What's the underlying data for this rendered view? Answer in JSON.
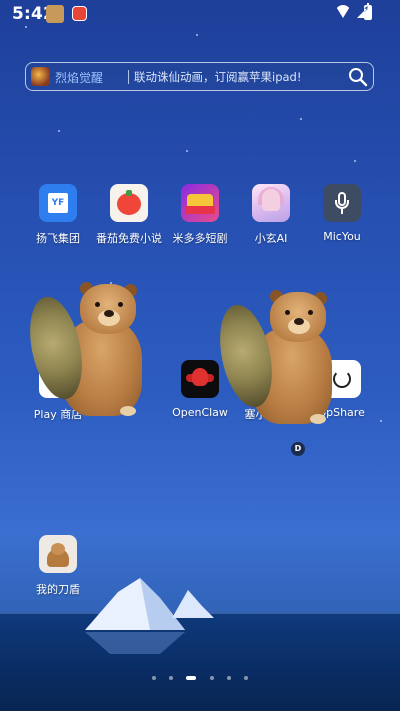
{
  "status_bar": {
    "time": "5:42",
    "icons": [
      "notification-avatar-icon",
      "notification-app-icon",
      "wifi-icon",
      "signal-icon",
      "battery-charging-icon"
    ]
  },
  "search_widget": {
    "app_name": "烈焰觉醒",
    "hint": "联动诛仙动画，订阅赢苹果ipad!",
    "icon": "search-icon"
  },
  "apps_row1": [
    {
      "label": "扬飞集团",
      "icon": "yangfei-icon",
      "logo_text": "YF"
    },
    {
      "label": "番茄免费小说",
      "icon": "tomato-novel-icon"
    },
    {
      "label": "米多多短剧",
      "icon": "midoduo-icon"
    },
    {
      "label": "小玄AI",
      "icon": "xiaoxuan-ai-icon"
    },
    {
      "label": "MicYou",
      "icon": "microphone-icon"
    }
  ],
  "apps_row2": [
    {
      "label": "Play 商店",
      "icon": "play-store-icon"
    },
    {
      "label": "OpenClaw",
      "icon": "openclaw-icon"
    },
    {
      "label": "塞小息",
      "icon": "sai-icon"
    },
    {
      "label": "ppShare",
      "icon": "share-icon"
    }
  ],
  "folder_badge": "D",
  "app_single": {
    "label": "我的刀盾",
    "icon": "dog-shield-icon"
  },
  "pager": {
    "count": 6,
    "active_index": 2
  },
  "colors": {
    "sky_top": "#1e3f9a",
    "sky_bottom": "#3b6fd0",
    "sea": "#0b2e64"
  }
}
